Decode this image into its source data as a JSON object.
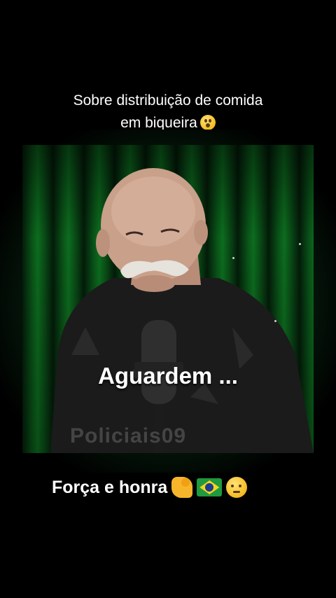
{
  "top_caption": {
    "line1": "Sobre distribuição de comida",
    "line2": "em biqueira",
    "emoji": "astonished-face-emoji"
  },
  "video": {
    "overlay_text": "Aguardem ...",
    "watermark": "Policiais09",
    "background_color": "#0e7a22"
  },
  "bottom_caption": {
    "text": "Força e honra",
    "emojis": [
      "flexed-biceps-emoji",
      "brazil-flag-emoji",
      "saluting-face-emoji"
    ]
  }
}
